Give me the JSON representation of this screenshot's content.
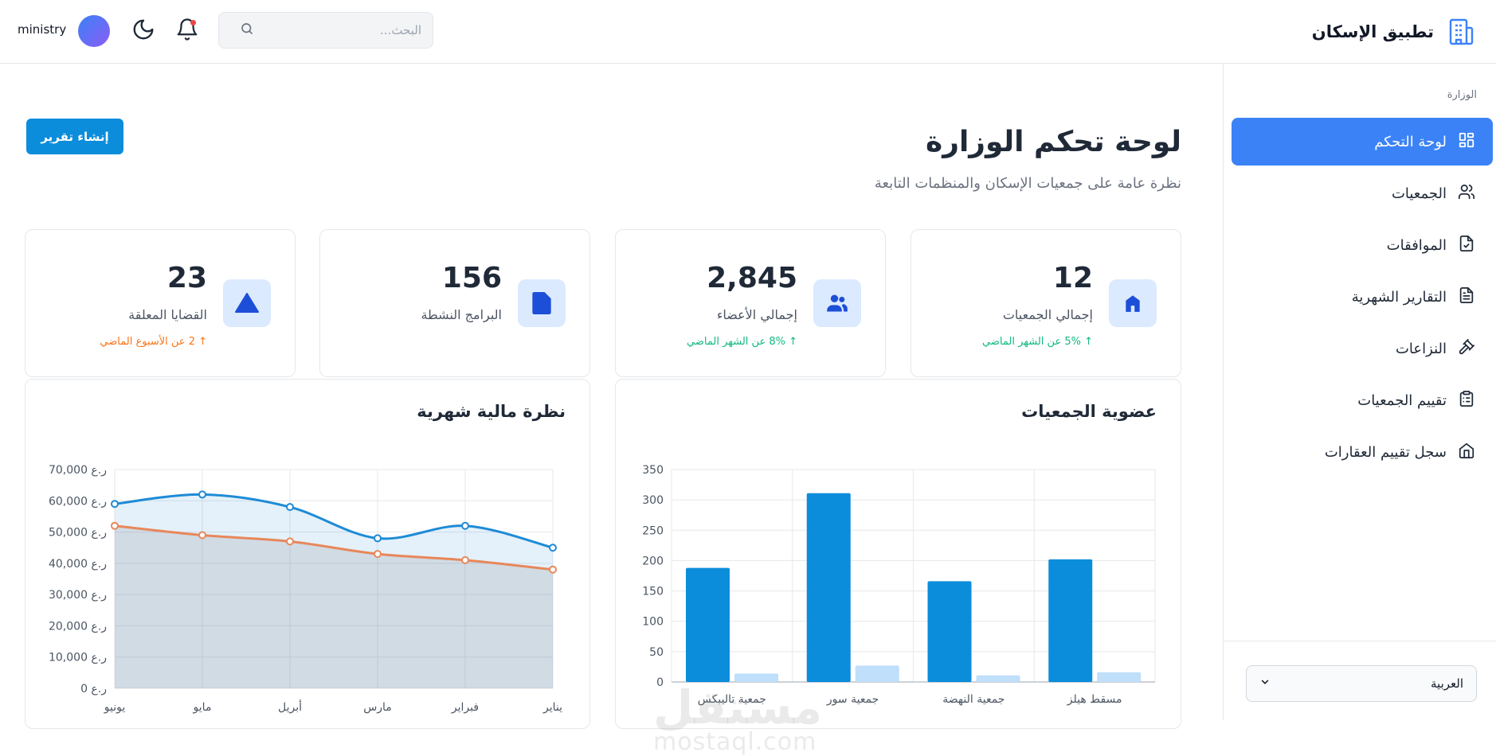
{
  "header": {
    "app_title": "تطبيق الإسكان",
    "search_placeholder": "البحث...",
    "username": "ministry"
  },
  "sidebar": {
    "section_label": "الوزارة",
    "items": [
      {
        "label": "لوحة التحكم",
        "icon": "dashboard-icon",
        "active": true
      },
      {
        "label": "الجمعيات",
        "icon": "users-icon",
        "active": false
      },
      {
        "label": "الموافقات",
        "icon": "file-check-icon",
        "active": false
      },
      {
        "label": "التقارير الشهرية",
        "icon": "file-text-icon",
        "active": false
      },
      {
        "label": "النزاعات",
        "icon": "gavel-icon",
        "active": false
      },
      {
        "label": "تقييم الجمعيات",
        "icon": "clipboard-icon",
        "active": false
      },
      {
        "label": "سجل تقييم العقارات",
        "icon": "home-icon",
        "active": false
      }
    ],
    "language": "العربية"
  },
  "main": {
    "title": "لوحة تحكم الوزارة",
    "subtitle": "نظرة عامة على جمعيات الإسكان والمنظمات التابعة",
    "create_report_label": "إنشاء تقرير",
    "stats": [
      {
        "value": "12",
        "label": "إجمالي الجمعيات",
        "trend": "↑ 5% عن الشهر الماضي",
        "icon": "building-icon"
      },
      {
        "value": "2,845",
        "label": "إجمالي الأعضاء",
        "trend": "↑ 8% عن الشهر الماضي",
        "icon": "users-icon"
      },
      {
        "value": "156",
        "label": "البرامج النشطة",
        "trend": "",
        "icon": "document-icon"
      },
      {
        "value": "23",
        "label": "القضايا المعلقة",
        "trend": "↑ 2 عن الأسبوع الماضي",
        "icon": "warning-icon"
      }
    ]
  },
  "colors": {
    "primary": "#3b82f6",
    "bar_dark": "#0b8ddb",
    "bar_light": "#bfdffa",
    "line_blue": "#1e8bd6",
    "line_orange": "#e8875a",
    "trend_up": "#10b981",
    "trend_warn": "#f97316"
  },
  "watermark": {
    "line1": "مستقل",
    "line2": "mostaql.com"
  },
  "chart_data": [
    {
      "type": "bar",
      "title": "عضوية الجمعيات",
      "categories": [
        "مسقط هيلز",
        "جمعية النهضة",
        "جمعية سور",
        "جمعية تاليبكس"
      ],
      "series": [
        {
          "values": [
            202,
            166,
            311,
            188
          ]
        },
        {
          "values": [
            16,
            11,
            27,
            14
          ]
        }
      ],
      "ylim": [
        0,
        350
      ],
      "yticks": [
        0,
        50,
        100,
        150,
        200,
        250,
        300,
        350
      ],
      "grid": true
    },
    {
      "type": "line",
      "title": "نظرة مالية شهرية",
      "categories": [
        "يناير",
        "فبراير",
        "مارس",
        "أبريل",
        "مايو",
        "يونيو"
      ],
      "series": [
        {
          "values": [
            45000,
            52000,
            48000,
            58000,
            62000,
            59000
          ]
        },
        {
          "values": [
            38000,
            41000,
            43000,
            47000,
            49000,
            52000
          ]
        }
      ],
      "ylim": [
        0,
        70000
      ],
      "yticks": [
        "0 ر.ع",
        "10,000 ر.ع",
        "20,000 ر.ع",
        "30,000 ر.ع",
        "40,000 ر.ع",
        "50,000 ر.ع",
        "60,000 ر.ع",
        "70,000 ر.ع"
      ],
      "grid": true
    }
  ]
}
